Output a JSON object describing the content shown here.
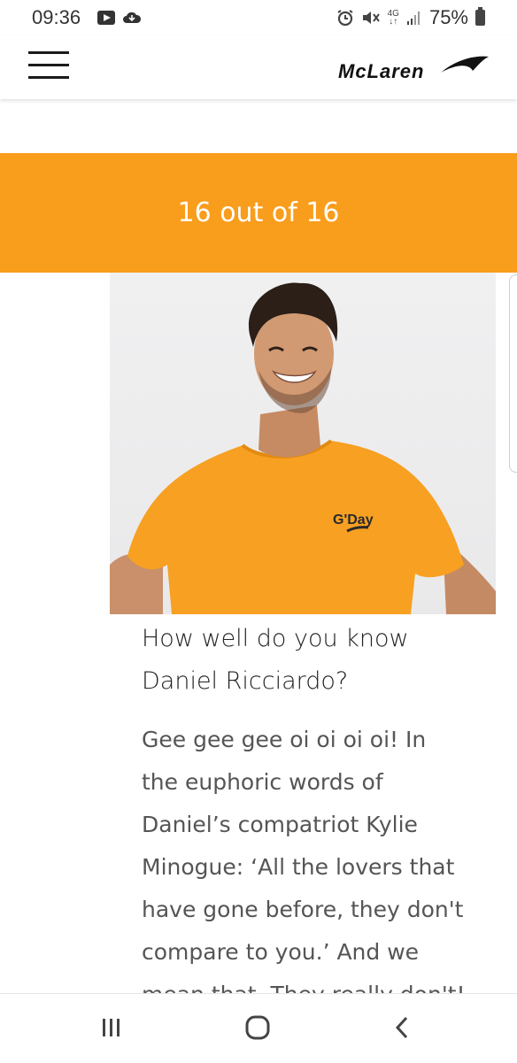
{
  "status_bar": {
    "time": "09:36",
    "network": "4G",
    "battery": "75%"
  },
  "header": {
    "logo_text": "McLaren"
  },
  "gallery": {
    "counter": "16 out of 16"
  },
  "photo": {
    "shirt_text": "G'Day"
  },
  "article": {
    "title": "How well do you know Daniel Ricciardo?",
    "body": "Gee gee gee oi oi oi oi! In the euphoric words of Daniel’s compatriot Kylie Minogue: ‘All the lovers that have gone before, they don't compare to you.’ And we mean that. They really don't!"
  },
  "colors": {
    "accent": "#f99d1c",
    "text": "#222222",
    "body_text": "#555555"
  },
  "icons": {
    "status": [
      "youtube-icon",
      "cloud-icon",
      "alarm-icon",
      "mute-icon",
      "signal-icon",
      "battery-icon"
    ],
    "nav": [
      "recents-icon",
      "home-icon",
      "back-icon"
    ]
  }
}
